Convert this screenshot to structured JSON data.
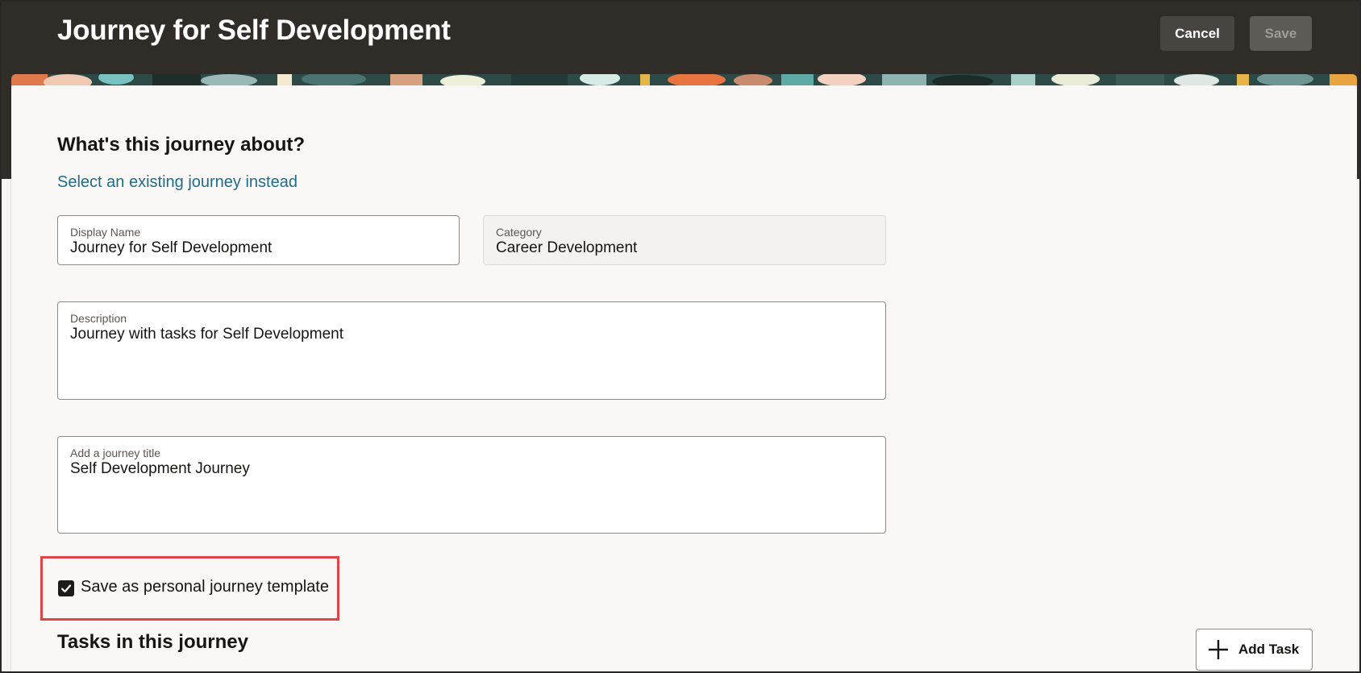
{
  "header": {
    "title": "Journey for Self Development",
    "cancel_label": "Cancel",
    "save_label": "Save"
  },
  "form": {
    "section_heading": "What's this journey about?",
    "select_existing_link": "Select an existing journey instead",
    "display_name": {
      "label": "Display Name",
      "value": "Journey for Self Development"
    },
    "category": {
      "label": "Category",
      "value": "Career Development"
    },
    "description": {
      "label": "Description",
      "value": "Journey with tasks for Self Development"
    },
    "journey_title": {
      "label": "Add a journey title",
      "value": "Self Development Journey"
    },
    "save_template": {
      "label": "Save as personal journey template",
      "checked": true
    }
  },
  "tasks": {
    "heading": "Tasks in this journey",
    "add_task_label": "Add Task"
  },
  "colors": {
    "header_bg": "#302c28",
    "link": "#1e6d8a",
    "highlight": "#e0454a"
  }
}
